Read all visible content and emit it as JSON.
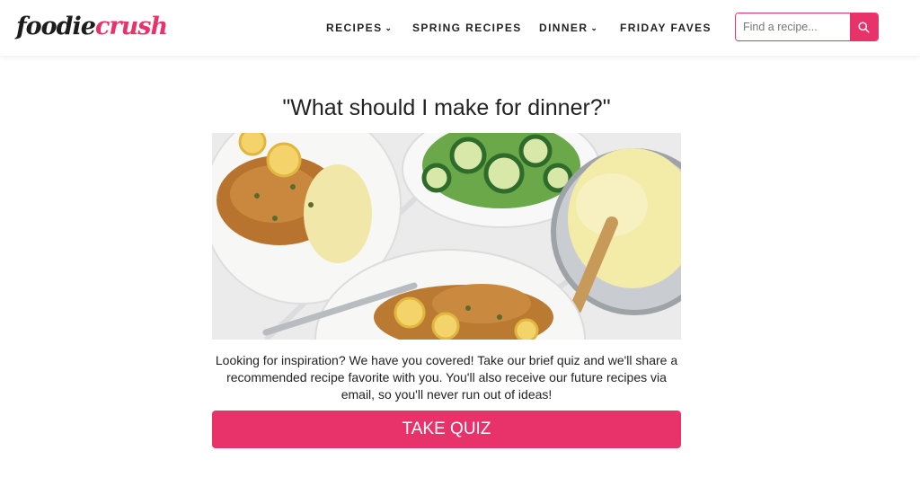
{
  "brand": {
    "logo_part1": "foodie",
    "logo_part2": "crush"
  },
  "nav": {
    "items": [
      {
        "label": "RECIPES",
        "has_dropdown": true
      },
      {
        "label": "SPRING RECIPES",
        "has_dropdown": false
      },
      {
        "label": "DINNER",
        "has_dropdown": true
      },
      {
        "label": "FRIDAY FAVES",
        "has_dropdown": false
      }
    ]
  },
  "search": {
    "placeholder": "Find a recipe...",
    "value": "",
    "icon": "search-icon"
  },
  "main": {
    "headline": "\"What should I make for dinner?\"",
    "hero_image": "chicken-piccata-dinner-photo",
    "description": "Looking for inspiration? We have you covered! Take our brief quiz and we'll share a recommended recipe favorite with you. You'll also receive our future recipes via email, so you'll never run out of ideas!",
    "cta_label": "TAKE QUIZ"
  },
  "colors": {
    "brand_pink": "#e8336a",
    "text": "#222222",
    "background": "#ffffff"
  }
}
